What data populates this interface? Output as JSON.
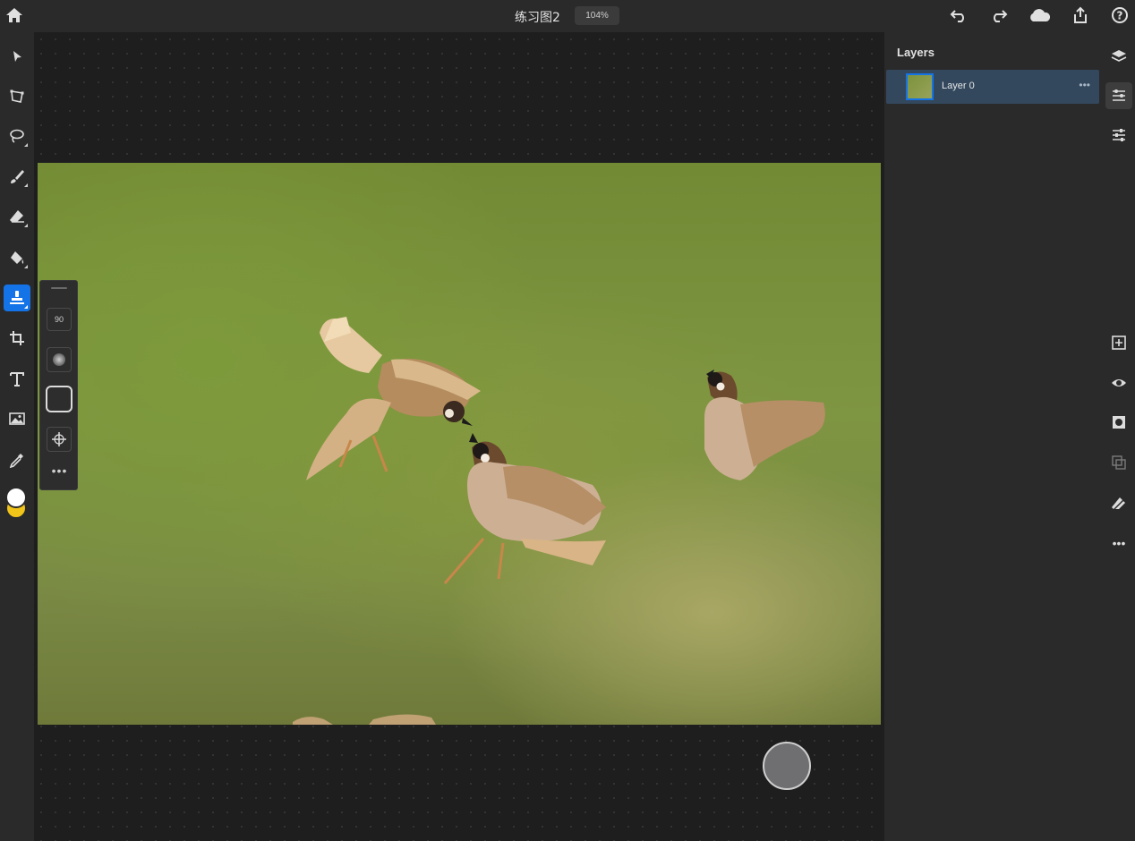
{
  "topbar": {
    "doc_title": "练习图2",
    "zoom": "104%",
    "icons": [
      "home-icon",
      "undo-icon",
      "redo-icon",
      "cloud-icon",
      "share-icon",
      "help-icon"
    ]
  },
  "tools": [
    {
      "name": "select-tool",
      "active": false
    },
    {
      "name": "transform-tool",
      "active": false
    },
    {
      "name": "lasso-tool",
      "active": false
    },
    {
      "name": "brush-tool",
      "active": false
    },
    {
      "name": "eraser-tool",
      "active": false
    },
    {
      "name": "fill-tool",
      "active": false
    },
    {
      "name": "clone-stamp-tool",
      "active": true
    },
    {
      "name": "crop-tool",
      "active": false
    },
    {
      "name": "type-tool",
      "active": false
    },
    {
      "name": "place-image-tool",
      "active": false
    },
    {
      "name": "eyedropper-tool",
      "active": false
    }
  ],
  "colors": {
    "foreground": "#ffffff",
    "background": "#f0c419",
    "accent": "#1473e6"
  },
  "brush_options": {
    "size": "90",
    "more": "•••"
  },
  "layers": {
    "title": "Layers",
    "items": [
      {
        "name": "Layer 0",
        "selected": true
      }
    ]
  },
  "right_rail": {
    "icons": [
      "layers-stack-icon",
      "layer-properties-icon",
      "adjustments-icon",
      "add-layer-icon",
      "visibility-icon",
      "mask-icon",
      "merge-icon",
      "clear-icon",
      "more-icon"
    ]
  }
}
